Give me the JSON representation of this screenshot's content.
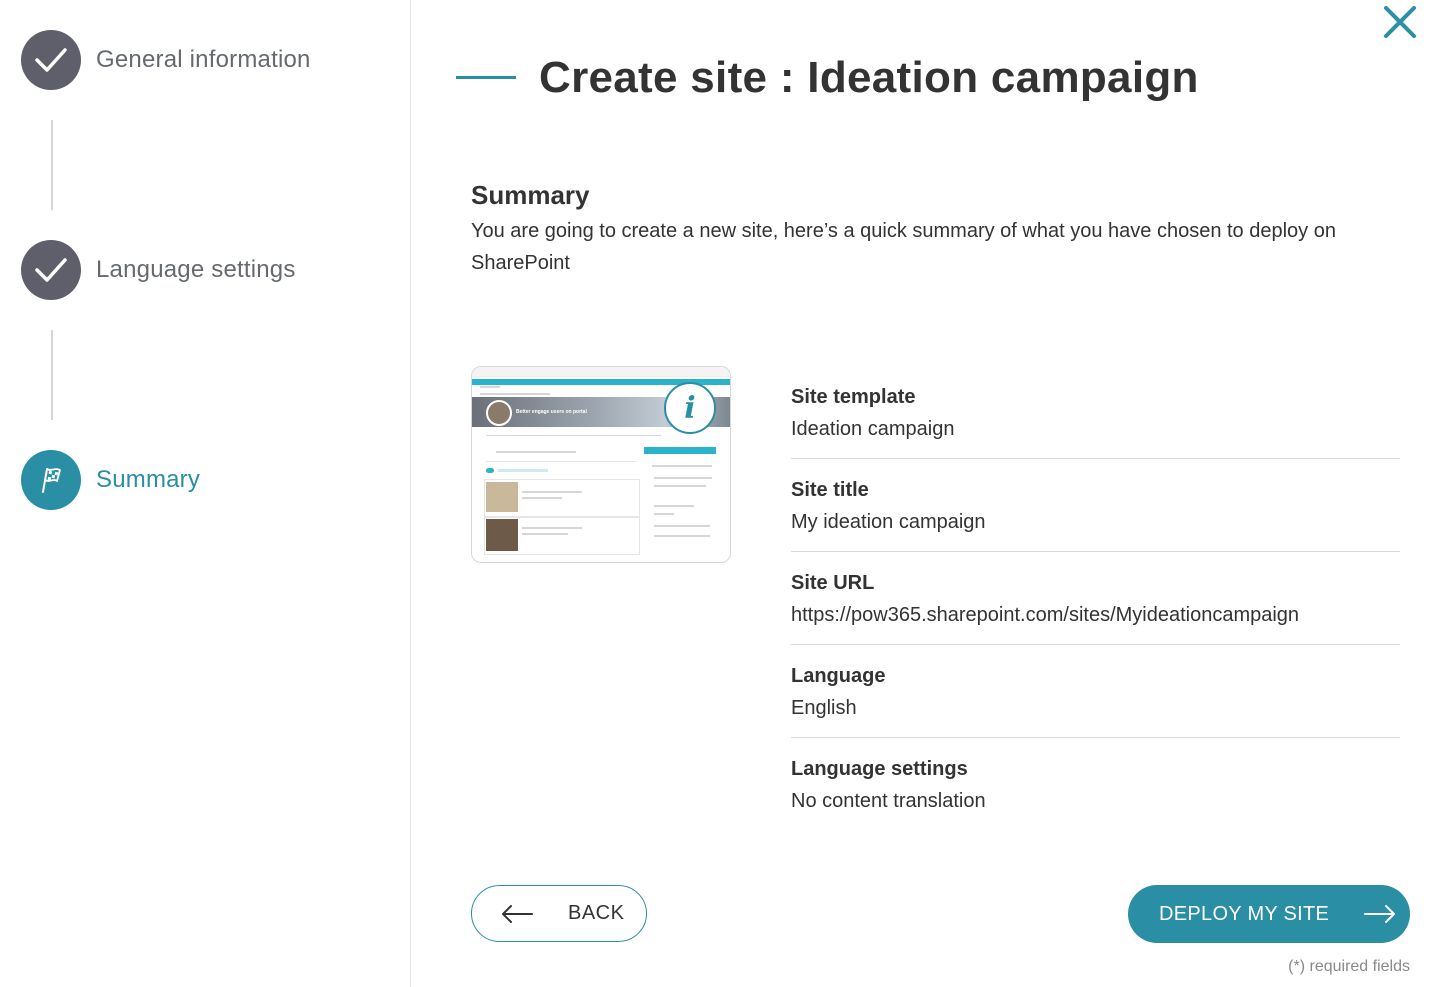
{
  "steps": [
    {
      "label": "General information",
      "state": "done",
      "icon": "check-icon"
    },
    {
      "label": "Language settings",
      "state": "done",
      "icon": "check-icon"
    },
    {
      "label": "Summary",
      "state": "active",
      "icon": "checkered-flag-icon"
    }
  ],
  "header": {
    "title": "Create site : Ideation campaign"
  },
  "summary": {
    "heading": "Summary",
    "description": "You are going to create a new site, here’s a quick summary of what you have chosen to deploy on SharePoint"
  },
  "preview": {
    "banner_text": "Better engage users on portal",
    "info_icon": "info-icon"
  },
  "details": [
    {
      "key": "Site template",
      "value": "Ideation campaign"
    },
    {
      "key": "Site title",
      "value": "My ideation campaign"
    },
    {
      "key": "Site URL",
      "value": "https://pow365.sharepoint.com/sites/Myideationcampaign"
    },
    {
      "key": "Language",
      "value": "English"
    },
    {
      "key": "Language settings",
      "value": "No content translation"
    }
  ],
  "buttons": {
    "back": "BACK",
    "deploy": "DEPLOY MY SITE"
  },
  "footer": {
    "required_note": "(*) required fields"
  },
  "colors": {
    "accent": "#2a8ea4",
    "done_step": "#5e5f6b",
    "text": "#333333"
  }
}
